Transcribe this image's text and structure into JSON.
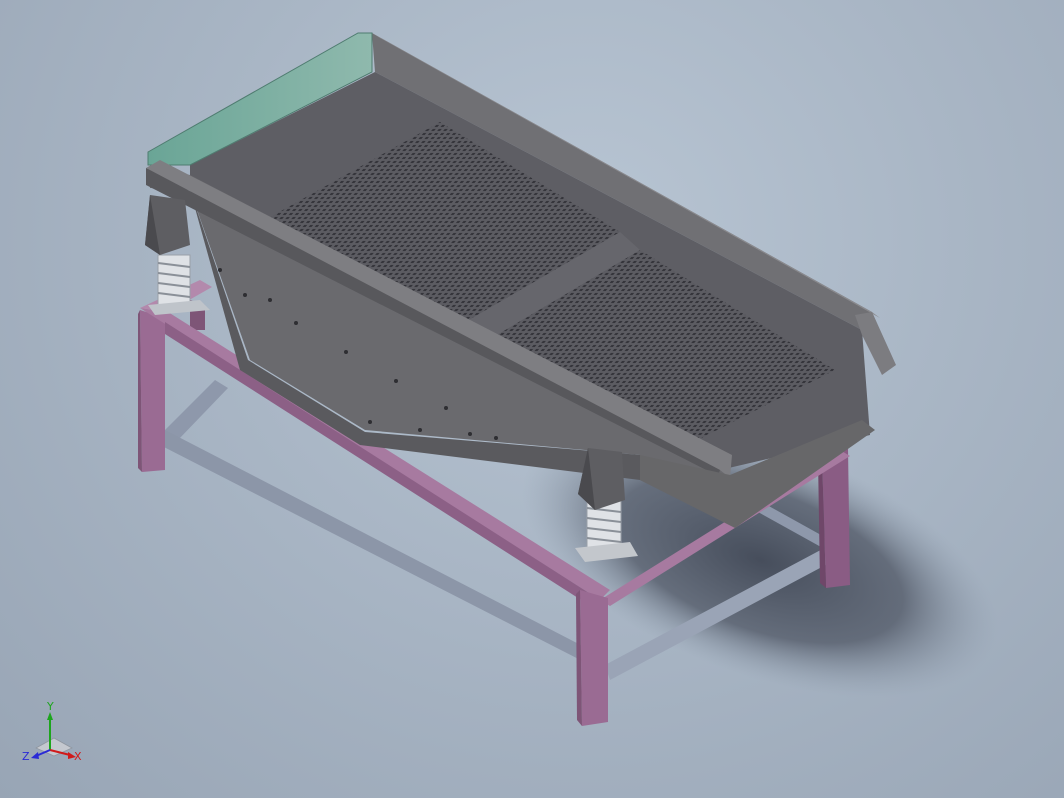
{
  "viewport": {
    "background_top": "#b8c5d3",
    "background_bottom": "#98a5b5"
  },
  "model": {
    "colors": {
      "frame": "#9a6b93",
      "frame_dark": "#7e5577",
      "brace": "#8e98ab",
      "housing": "#6e6e72",
      "housing_dark": "#58585c",
      "housing_light": "#858589",
      "screen_bg": "#5c5c62",
      "screen_slot": "#3a3a40",
      "glass": "#74a79a",
      "spring": "#cfd2d6",
      "shadow": "#4e5563"
    }
  },
  "triad": {
    "x_label": "X",
    "y_label": "Y",
    "z_label": "Z",
    "x_color": "#d11a1a",
    "y_color": "#1da51d",
    "z_color": "#2a2ad6"
  }
}
